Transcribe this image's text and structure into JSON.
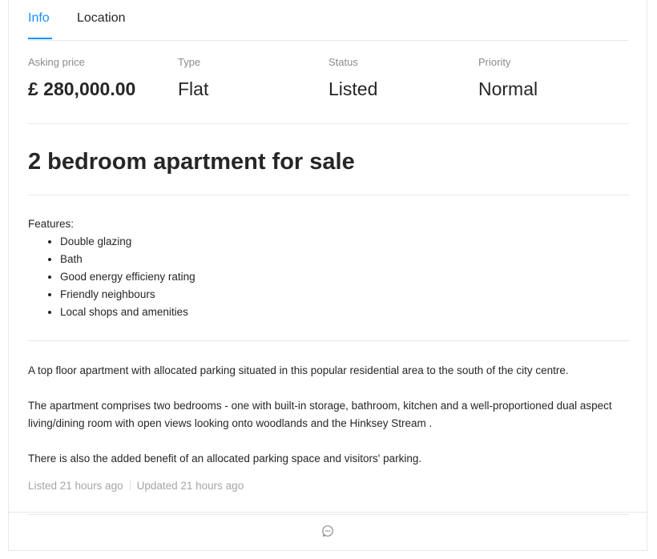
{
  "tabs": [
    {
      "label": "Info",
      "active": true
    },
    {
      "label": "Location",
      "active": false
    }
  ],
  "stats": {
    "asking_price": {
      "label": "Asking price",
      "value": "£ 280,000.00"
    },
    "type": {
      "label": "Type",
      "value": "Flat"
    },
    "status": {
      "label": "Status",
      "value": "Listed"
    },
    "priority": {
      "label": "Priority",
      "value": "Normal"
    }
  },
  "title": "2 bedroom apartment for sale",
  "features": {
    "label": "Features:",
    "items": [
      "Double glazing",
      "Bath",
      "Good energy efficieny rating",
      "Friendly neighbours",
      "Local shops and amenities"
    ]
  },
  "description": [
    "A top floor apartment with allocated parking situated in this popular residential area to the south of the city centre.",
    "The apartment comprises two bedrooms - one with built-in storage, bathroom, kitchen and a well-proportioned dual aspect living/dining room with open views looking onto woodlands and the Hinksey Stream .",
    "There is also the added benefit of an allocated parking space and visitors' parking."
  ],
  "meta": {
    "listed": "Listed 21 hours ago",
    "updated": "Updated 21 hours ago"
  },
  "footer": {
    "action_icon": "comment-icon"
  },
  "colors": {
    "accent": "#1890ff",
    "text": "#262626",
    "muted": "#8c8c8c",
    "border": "#e8e8e8"
  }
}
